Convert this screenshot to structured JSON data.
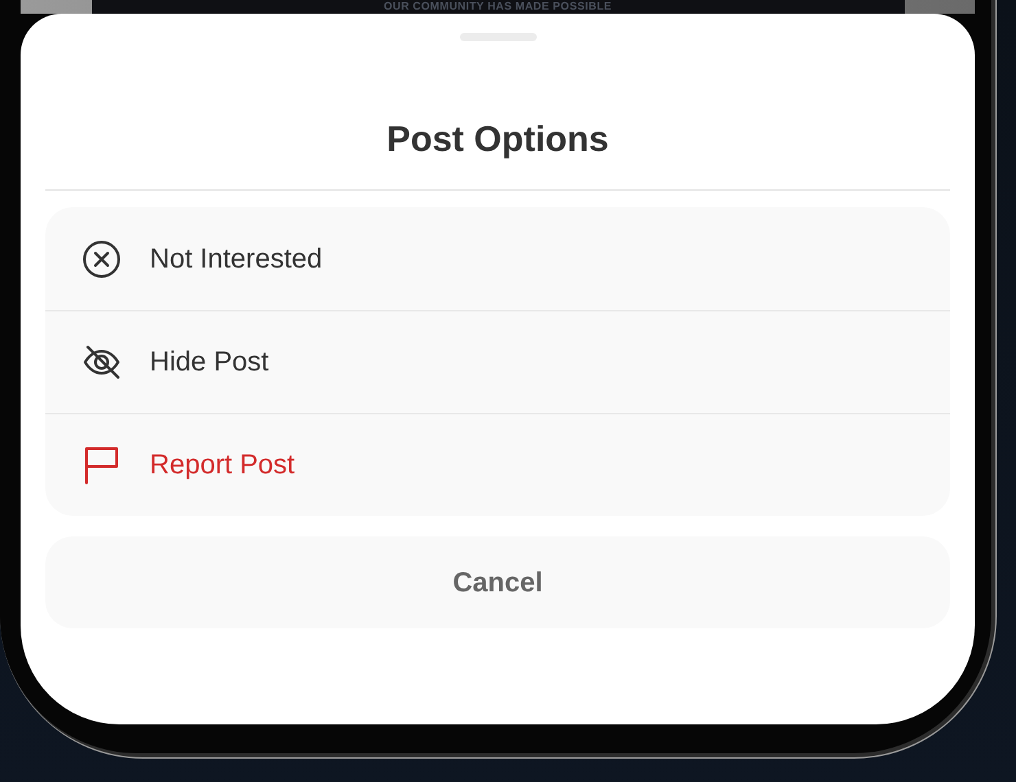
{
  "background": {
    "caption": "OUR COMMUNITY HAS MADE POSSIBLE"
  },
  "sheet": {
    "title": "Post Options",
    "options": [
      {
        "label": "Not Interested",
        "kind": "normal"
      },
      {
        "label": "Hide Post",
        "kind": "normal"
      },
      {
        "label": "Report Post",
        "kind": "destructive"
      }
    ],
    "cancel": "Cancel"
  }
}
